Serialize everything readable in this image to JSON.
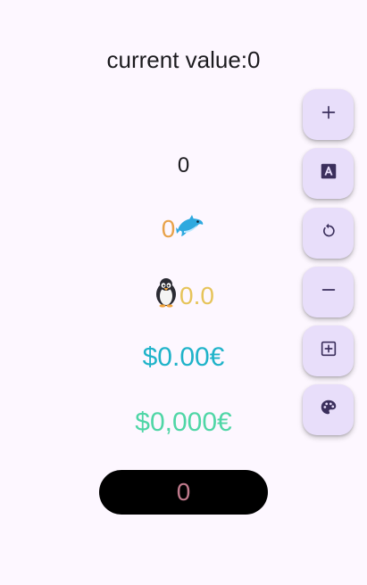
{
  "header": {
    "title": "current value:0"
  },
  "values": {
    "plain": "0",
    "dolphin": "0",
    "penguin": "0.0",
    "currency": "$0.00€",
    "currency_grouped": "$0,000€",
    "pill": "0"
  },
  "fabs": [
    {
      "name": "add-button",
      "icon": "plus-icon"
    },
    {
      "name": "text-format-button",
      "icon": "text-format-icon"
    },
    {
      "name": "reset-button",
      "icon": "refresh-icon"
    },
    {
      "name": "subtract-button",
      "icon": "minus-icon"
    },
    {
      "name": "add-box-button",
      "icon": "plus-box-icon"
    },
    {
      "name": "palette-button",
      "icon": "palette-icon"
    }
  ],
  "colors": {
    "background": "#fdf7ff",
    "fab": "#e8defa",
    "dolphin_text": "#e8a24a",
    "penguin_text": "#e6c45a",
    "currency_text": "#1fb3c9",
    "currency_grouped_text": "#4fd6a6",
    "pill_bg": "#000000",
    "pill_text": "#c07a8c"
  }
}
